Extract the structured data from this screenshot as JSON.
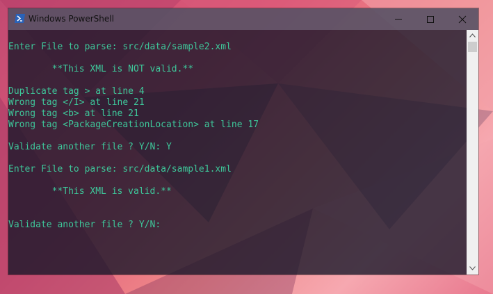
{
  "window": {
    "title": "Windows PowerShell",
    "icon": "powershell-icon",
    "controls": {
      "minimize": "minimize-icon",
      "maximize": "maximize-icon",
      "close": "close-icon"
    }
  },
  "console": {
    "text_color": "#3ec79a",
    "lines": [
      "Enter File to parse: src/data/sample2.xml",
      "",
      "        **This XML is NOT valid.**",
      "",
      "Duplicate tag > at line 4",
      "Wrong tag </I> at line 21",
      "Wrong tag <b> at line 21",
      "Wrong tag <PackageCreationLocation> at line 17",
      "",
      "Validate another file ? Y/N: Y",
      "",
      "Enter File to parse: src/data/sample1.xml",
      "",
      "        **This XML is valid.**",
      "",
      "",
      "Validate another file ? Y/N: "
    ]
  },
  "scrollbar": {
    "up": "chevron-up-icon",
    "down": "chevron-down-icon"
  }
}
